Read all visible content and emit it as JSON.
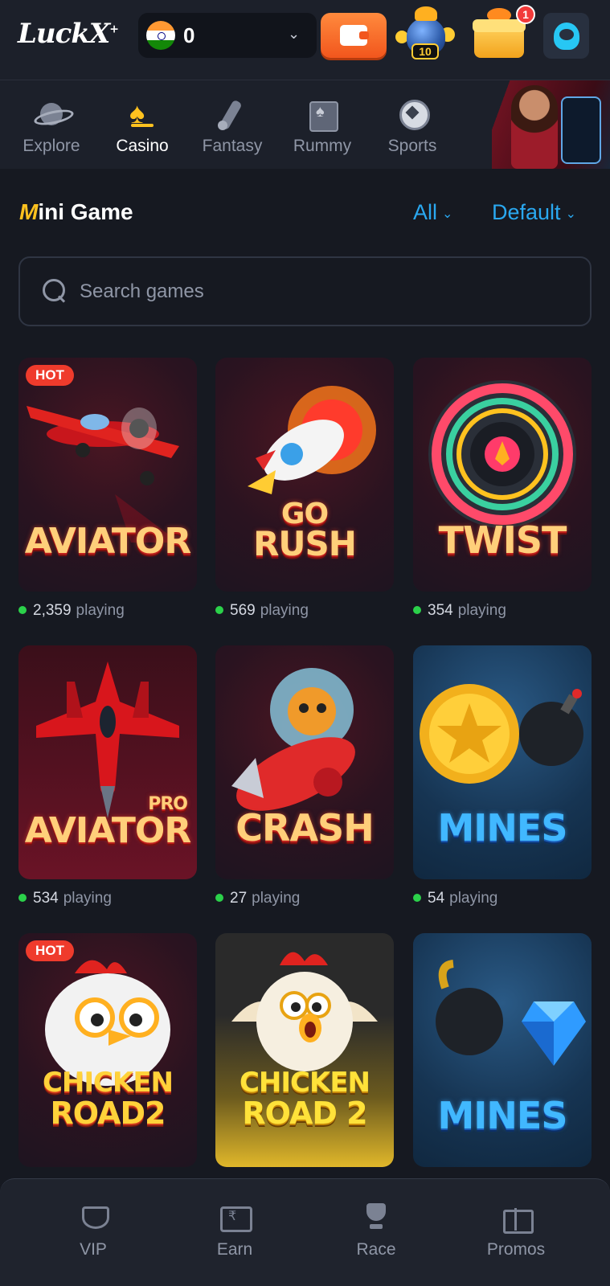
{
  "header": {
    "logo_text": "LuckX",
    "logo_mark": "+",
    "balance": "0",
    "currency_flag": "india-flag-icon",
    "jackpot_value": "10",
    "notification_count": "1",
    "accent_color": "#f2561d"
  },
  "categories": [
    {
      "label": "Explore",
      "icon": "planet-icon",
      "active": false
    },
    {
      "label": "Casino",
      "icon": "spade-icon",
      "active": true
    },
    {
      "label": "Fantasy",
      "icon": "cricket-bat-icon",
      "active": false
    },
    {
      "label": "Rummy",
      "icon": "cards-icon",
      "active": false
    },
    {
      "label": "Sports",
      "icon": "football-icon",
      "active": false
    }
  ],
  "section": {
    "title_accent": "M",
    "title_rest": "ini Game",
    "filter_type": "All",
    "filter_sort": "Default",
    "link_color": "#2aa8f0"
  },
  "search": {
    "placeholder": "Search games",
    "value": ""
  },
  "games": [
    {
      "title": "AVIATOR",
      "badge": "HOT",
      "players": "2,359",
      "players_label": "playing"
    },
    {
      "title_line1": "GO",
      "title_line2": "RUSH",
      "players": "569",
      "players_label": "playing"
    },
    {
      "title": "TWIST",
      "players": "354",
      "players_label": "playing"
    },
    {
      "title": "AVIATOR",
      "subtitle": "PRO",
      "players": "534",
      "players_label": "playing"
    },
    {
      "title": "CRASH",
      "players": "27",
      "players_label": "playing"
    },
    {
      "title": "MINES",
      "players": "54",
      "players_label": "playing"
    },
    {
      "title_line1": "CHICKEN",
      "title_line2": "ROAD2",
      "badge": "HOT"
    },
    {
      "title_line1": "CHICKEN",
      "title_line2": "ROAD 2"
    },
    {
      "title": "MINES"
    }
  ],
  "bottom_nav": [
    {
      "label": "VIP",
      "icon": "vip-diamond-icon"
    },
    {
      "label": "Earn",
      "icon": "earn-wallet-icon"
    },
    {
      "label": "Race",
      "icon": "race-trophy-icon"
    },
    {
      "label": "Promos",
      "icon": "promos-gift-icon"
    }
  ]
}
